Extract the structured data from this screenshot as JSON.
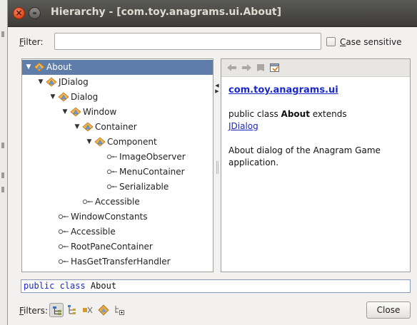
{
  "window": {
    "title": "Hierarchy - [com.toy.anagrams.ui.About]"
  },
  "filter": {
    "label_mnemonic": "F",
    "label_rest": "ilter:",
    "value": "",
    "case_mnemonic": "C",
    "case_rest": "ase sensitive",
    "case_checked": false
  },
  "tree": [
    {
      "label": "About",
      "depth": 0,
      "expanded": true,
      "icon": "class-icon",
      "selected": true
    },
    {
      "label": "JDialog",
      "depth": 1,
      "expanded": true,
      "icon": "class-icon"
    },
    {
      "label": "Dialog",
      "depth": 2,
      "expanded": true,
      "icon": "class-icon"
    },
    {
      "label": "Window",
      "depth": 3,
      "expanded": true,
      "icon": "class-icon"
    },
    {
      "label": "Container",
      "depth": 4,
      "expanded": true,
      "icon": "class-icon"
    },
    {
      "label": "Component",
      "depth": 5,
      "expanded": true,
      "icon": "class-icon"
    },
    {
      "label": "ImageObserver",
      "depth": 6,
      "icon": "interface-icon"
    },
    {
      "label": "MenuContainer",
      "depth": 6,
      "icon": "interface-icon"
    },
    {
      "label": "Serializable",
      "depth": 6,
      "icon": "interface-icon"
    },
    {
      "label": "Accessible",
      "depth": 4,
      "icon": "interface-icon"
    },
    {
      "label": "WindowConstants",
      "depth": 2,
      "icon": "interface-icon"
    },
    {
      "label": "Accessible",
      "depth": 2,
      "icon": "interface-icon"
    },
    {
      "label": "RootPaneContainer",
      "depth": 2,
      "icon": "interface-icon"
    },
    {
      "label": "HasGetTransferHandler",
      "depth": 2,
      "icon": "interface-icon"
    }
  ],
  "doc": {
    "package": "com.toy.anagrams.ui",
    "sig_prefix": "public class ",
    "sig_name": "About",
    "sig_suffix": " extends",
    "sig_link": "JDialog",
    "description": "About dialog of the Anagram Game application."
  },
  "signature": {
    "keyword": "public class",
    "name": " About"
  },
  "bottom": {
    "filters_mnemonic": "F",
    "filters_rest": "ilters:",
    "close_label": "Close"
  }
}
